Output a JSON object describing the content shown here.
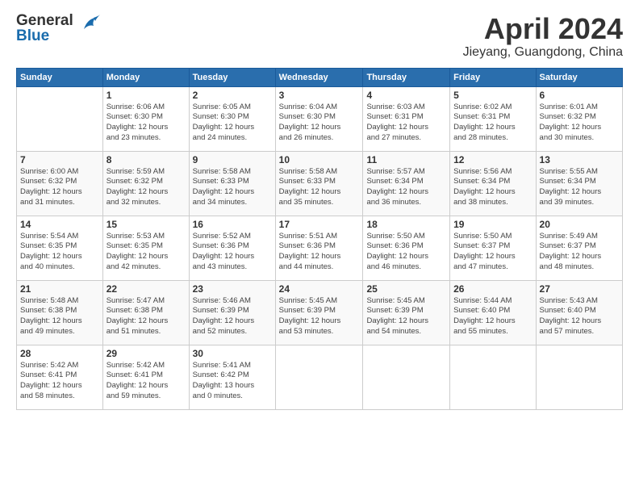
{
  "logo": {
    "line1": "General",
    "line2": "Blue"
  },
  "title": "April 2024",
  "location": "Jieyang, Guangdong, China",
  "weekdays": [
    "Sunday",
    "Monday",
    "Tuesday",
    "Wednesday",
    "Thursday",
    "Friday",
    "Saturday"
  ],
  "weeks": [
    [
      {
        "day": "",
        "info": ""
      },
      {
        "day": "1",
        "info": "Sunrise: 6:06 AM\nSunset: 6:30 PM\nDaylight: 12 hours\nand 23 minutes."
      },
      {
        "day": "2",
        "info": "Sunrise: 6:05 AM\nSunset: 6:30 PM\nDaylight: 12 hours\nand 24 minutes."
      },
      {
        "day": "3",
        "info": "Sunrise: 6:04 AM\nSunset: 6:30 PM\nDaylight: 12 hours\nand 26 minutes."
      },
      {
        "day": "4",
        "info": "Sunrise: 6:03 AM\nSunset: 6:31 PM\nDaylight: 12 hours\nand 27 minutes."
      },
      {
        "day": "5",
        "info": "Sunrise: 6:02 AM\nSunset: 6:31 PM\nDaylight: 12 hours\nand 28 minutes."
      },
      {
        "day": "6",
        "info": "Sunrise: 6:01 AM\nSunset: 6:32 PM\nDaylight: 12 hours\nand 30 minutes."
      }
    ],
    [
      {
        "day": "7",
        "info": "Sunrise: 6:00 AM\nSunset: 6:32 PM\nDaylight: 12 hours\nand 31 minutes."
      },
      {
        "day": "8",
        "info": "Sunrise: 5:59 AM\nSunset: 6:32 PM\nDaylight: 12 hours\nand 32 minutes."
      },
      {
        "day": "9",
        "info": "Sunrise: 5:58 AM\nSunset: 6:33 PM\nDaylight: 12 hours\nand 34 minutes."
      },
      {
        "day": "10",
        "info": "Sunrise: 5:58 AM\nSunset: 6:33 PM\nDaylight: 12 hours\nand 35 minutes."
      },
      {
        "day": "11",
        "info": "Sunrise: 5:57 AM\nSunset: 6:34 PM\nDaylight: 12 hours\nand 36 minutes."
      },
      {
        "day": "12",
        "info": "Sunrise: 5:56 AM\nSunset: 6:34 PM\nDaylight: 12 hours\nand 38 minutes."
      },
      {
        "day": "13",
        "info": "Sunrise: 5:55 AM\nSunset: 6:34 PM\nDaylight: 12 hours\nand 39 minutes."
      }
    ],
    [
      {
        "day": "14",
        "info": "Sunrise: 5:54 AM\nSunset: 6:35 PM\nDaylight: 12 hours\nand 40 minutes."
      },
      {
        "day": "15",
        "info": "Sunrise: 5:53 AM\nSunset: 6:35 PM\nDaylight: 12 hours\nand 42 minutes."
      },
      {
        "day": "16",
        "info": "Sunrise: 5:52 AM\nSunset: 6:36 PM\nDaylight: 12 hours\nand 43 minutes."
      },
      {
        "day": "17",
        "info": "Sunrise: 5:51 AM\nSunset: 6:36 PM\nDaylight: 12 hours\nand 44 minutes."
      },
      {
        "day": "18",
        "info": "Sunrise: 5:50 AM\nSunset: 6:36 PM\nDaylight: 12 hours\nand 46 minutes."
      },
      {
        "day": "19",
        "info": "Sunrise: 5:50 AM\nSunset: 6:37 PM\nDaylight: 12 hours\nand 47 minutes."
      },
      {
        "day": "20",
        "info": "Sunrise: 5:49 AM\nSunset: 6:37 PM\nDaylight: 12 hours\nand 48 minutes."
      }
    ],
    [
      {
        "day": "21",
        "info": "Sunrise: 5:48 AM\nSunset: 6:38 PM\nDaylight: 12 hours\nand 49 minutes."
      },
      {
        "day": "22",
        "info": "Sunrise: 5:47 AM\nSunset: 6:38 PM\nDaylight: 12 hours\nand 51 minutes."
      },
      {
        "day": "23",
        "info": "Sunrise: 5:46 AM\nSunset: 6:39 PM\nDaylight: 12 hours\nand 52 minutes."
      },
      {
        "day": "24",
        "info": "Sunrise: 5:45 AM\nSunset: 6:39 PM\nDaylight: 12 hours\nand 53 minutes."
      },
      {
        "day": "25",
        "info": "Sunrise: 5:45 AM\nSunset: 6:39 PM\nDaylight: 12 hours\nand 54 minutes."
      },
      {
        "day": "26",
        "info": "Sunrise: 5:44 AM\nSunset: 6:40 PM\nDaylight: 12 hours\nand 55 minutes."
      },
      {
        "day": "27",
        "info": "Sunrise: 5:43 AM\nSunset: 6:40 PM\nDaylight: 12 hours\nand 57 minutes."
      }
    ],
    [
      {
        "day": "28",
        "info": "Sunrise: 5:42 AM\nSunset: 6:41 PM\nDaylight: 12 hours\nand 58 minutes."
      },
      {
        "day": "29",
        "info": "Sunrise: 5:42 AM\nSunset: 6:41 PM\nDaylight: 12 hours\nand 59 minutes."
      },
      {
        "day": "30",
        "info": "Sunrise: 5:41 AM\nSunset: 6:42 PM\nDaylight: 13 hours\nand 0 minutes."
      },
      {
        "day": "",
        "info": ""
      },
      {
        "day": "",
        "info": ""
      },
      {
        "day": "",
        "info": ""
      },
      {
        "day": "",
        "info": ""
      }
    ]
  ]
}
